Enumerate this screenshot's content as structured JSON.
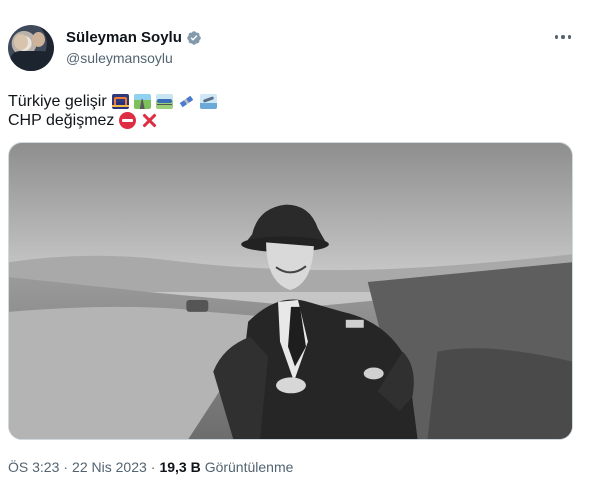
{
  "author": {
    "display_name": "Süleyman Soylu",
    "handle": "@suleymansoylu",
    "verified_color": "#829aab"
  },
  "tweet": {
    "line1_text": "Türkiye gelişir",
    "line1_emojis": [
      "bridge-at-night",
      "motorway",
      "railway-track",
      "satellite",
      "airplane"
    ],
    "line2_text": "CHP değişmez",
    "line2_emojis": [
      "no-entry",
      "cross-mark"
    ]
  },
  "media": {
    "alt": "photo"
  },
  "meta": {
    "time": "ÖS 3:23",
    "separator": "·",
    "date": "22 Nis 2023",
    "views_count": "19,3 B",
    "views_label": "Görüntülenme"
  },
  "colors": {
    "text": "#0f1419",
    "secondary_text": "#536471",
    "emoji_red": "#dd2e44"
  }
}
